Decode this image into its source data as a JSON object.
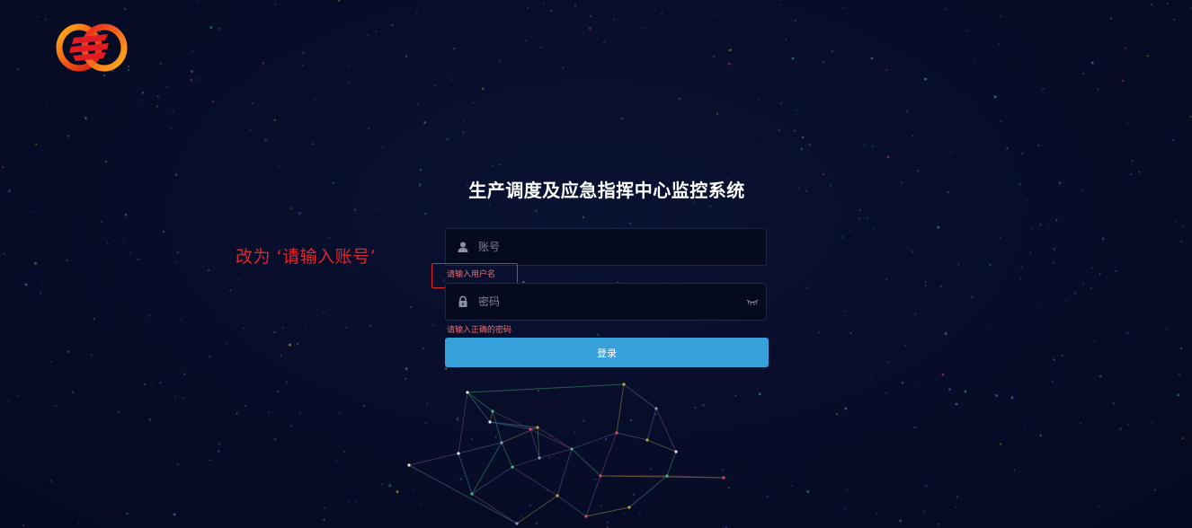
{
  "app": {
    "title": "生产调度及应急指挥中心监控系统",
    "logo_icon": "company-logo-icon"
  },
  "login": {
    "username": {
      "placeholder": "账号",
      "value": "",
      "icon": "user-icon",
      "error": "请输入用户名"
    },
    "password": {
      "placeholder": "密码",
      "value": "",
      "icon": "lock-icon",
      "toggle_icon": "eye-closed-icon",
      "error": "请输入正确的密码"
    },
    "submit_label": "登录"
  },
  "annotation": {
    "text": "改为 ‘请输入账号’",
    "color": "#e0262a"
  },
  "colors": {
    "background": "#060c26",
    "accent": "#35a0d9",
    "error": "#f26d6d"
  }
}
